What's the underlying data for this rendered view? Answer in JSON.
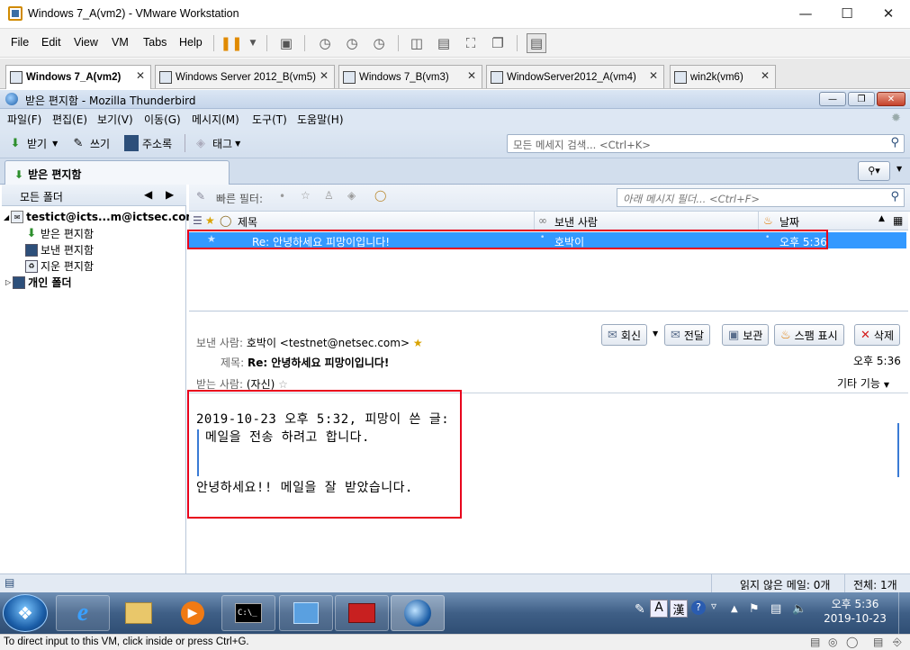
{
  "vmware": {
    "window_title": "Windows 7_A(vm2) - VMware Workstation",
    "menu": [
      "File",
      "Edit",
      "View",
      "VM",
      "Tabs",
      "Help"
    ],
    "tabs": [
      {
        "label": "Windows 7_A(vm2)",
        "active": true
      },
      {
        "label": "Windows Server 2012_B(vm5)",
        "active": false
      },
      {
        "label": "Windows 7_B(vm3)",
        "active": false
      },
      {
        "label": "WindowServer2012_A(vm4)",
        "active": false
      },
      {
        "label": "win2k(vm6)",
        "active": false
      }
    ],
    "status_text": "To direct input to this VM, click inside or press Ctrl+G."
  },
  "thunderbird": {
    "window_title": "받은 편지함 - Mozilla Thunderbird",
    "menu": [
      "파일(F)",
      "편집(E)",
      "보기(V)",
      "이동(G)",
      "메시지(M)",
      "도구(T)",
      "도움말(H)"
    ],
    "toolbar": {
      "get": "받기",
      "write": "쓰기",
      "address_book": "주소록",
      "tag": "태그",
      "search_placeholder": "모든 메세지 검색... <Ctrl+K>"
    },
    "tab_label": "받은 편지함",
    "folder_pane": {
      "header": "모든 폴더",
      "account": "testict@icts...m@ictsec.com",
      "folders": [
        "받은 편지함",
        "보낸 편지함",
        "지운 편지함"
      ],
      "local": "개인 폴더"
    },
    "quick_filter": {
      "label": "빠른 필터:",
      "placeholder": "아래 메시지 필더... <Ctrl+F>"
    },
    "columns": {
      "subject": "제목",
      "from": "보낸 사람",
      "date": "날짜"
    },
    "messages": [
      {
        "subject": "Re: 안녕하세요 피망이입니다!",
        "from": "호박이",
        "date": "오후 5:36"
      }
    ],
    "reading": {
      "from_label": "보낸 사람:",
      "from_value": "호박이 <testnet@netsec.com>",
      "subject_label": "제목:",
      "subject_value": "Re: 안녕하세요 피망이입니다!",
      "to_label": "받는 사람:",
      "to_value": "(자신)",
      "time": "오후 5:36",
      "other_actions": "기타 기능",
      "buttons": {
        "reply": "회신",
        "forward": "전달",
        "archive": "보관",
        "junk": "스팸 표시",
        "delete": "삭제"
      },
      "body": {
        "quote_header": "2019-10-23 오후 5:32, 피망이 쓴 글:",
        "quote_text": "메일을 전송 하려고 합니다.",
        "reply_text": "안녕하세요!! 메일을 잘 받았습니다."
      }
    },
    "status": {
      "unread": "읽지 않은 메일: 0개",
      "total": "전체: 1개"
    }
  },
  "taskbar": {
    "ime_a": "A",
    "ime_han": "漢",
    "clock_time": "오후 5:36",
    "clock_date": "2019-10-23"
  }
}
